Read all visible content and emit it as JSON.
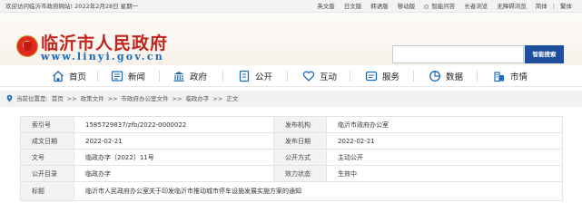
{
  "topbar": {
    "welcome": "欢迎访问临沂市政府网站! 2022年2月28日 星期一",
    "links": [
      "英文版",
      "日文版",
      "韩语版",
      "移动版",
      "智能问答",
      "长者浏览",
      "无障碍浏览",
      "简体",
      "繁体"
    ]
  },
  "header": {
    "title": "临沂市人民政府",
    "url": "www.linyi.gov.cn",
    "search_placeholder": "",
    "search_button": "智能搜索"
  },
  "nav": {
    "items": [
      {
        "label": "首页",
        "icon": "home-icon"
      },
      {
        "label": "新闻",
        "icon": "news-icon"
      },
      {
        "label": "政府",
        "icon": "government-icon"
      },
      {
        "label": "公开",
        "icon": "open-icon"
      },
      {
        "label": "互动",
        "icon": "interaction-icon"
      },
      {
        "label": "服务",
        "icon": "service-icon"
      },
      {
        "label": "数据",
        "icon": "data-icon"
      },
      {
        "label": "市情",
        "icon": "city-icon"
      }
    ]
  },
  "breadcrumb": {
    "prefix": "当前位置是:",
    "items": [
      "首页",
      "政策文件",
      "市政府办公室文件",
      "临政办字",
      "正文"
    ],
    "separator": ">>"
  },
  "meta": {
    "rows": [
      {
        "k1": "索引号",
        "v1": "1585729837/zfb/2022-0000022",
        "k2": "发布机构",
        "v2": "临沂市政府办公室"
      },
      {
        "k1": "成文日期",
        "v1": "2022-02-21",
        "k2": "发布日期",
        "v2": "2022-02-21"
      },
      {
        "k1": "文号",
        "v1": "临政办字〔2022〕11号",
        "k2": "公开方式",
        "v2": "主动公开"
      },
      {
        "k1": "公开目录",
        "v1": "临政办字",
        "k2": "效力状态",
        "v2": "生效中"
      }
    ],
    "title_key": "标题",
    "title_value": "临沂市人民政府办公室关于印发临沂市推动城市停车设施发展实施方案的通知"
  },
  "colors": {
    "brand_red": "#c0241c",
    "brand_blue": "#1c6bb6",
    "search_button": "#1d4f9c"
  }
}
